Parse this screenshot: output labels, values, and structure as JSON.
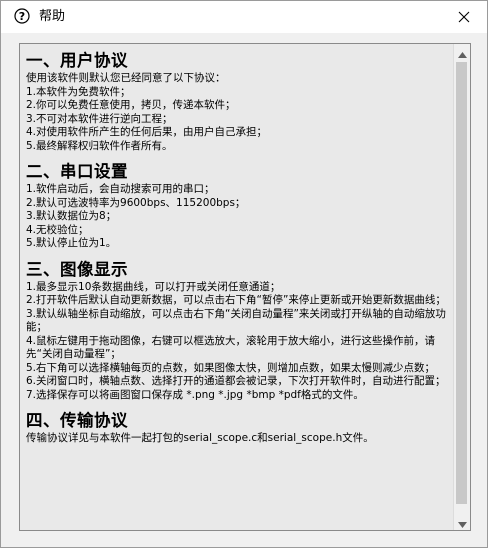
{
  "window": {
    "title": "帮助"
  },
  "sections": [
    {
      "heading": "一、用户协议",
      "lines": [
        "使用该软件则默认您已经同意了以下协议：",
        "1.本软件为免费软件；",
        "2.你可以免费任意使用，拷贝，传递本软件；",
        "3.不可对本软件进行逆向工程；",
        "4.对使用软件所产生的任何后果，由用户自己承担；",
        "5.最终解释权归软件作者所有。"
      ]
    },
    {
      "heading": "二、串口设置",
      "lines": [
        "1.软件启动后，会自动搜索可用的串口；",
        "2.默认可选波特率为9600bps、115200bps；",
        "3.默认数据位为8；",
        "4.无校验位；",
        "5.默认停止位为1。"
      ]
    },
    {
      "heading": "三、图像显示",
      "lines": [
        "1.最多显示10条数据曲线，可以打开或关闭任意通道；",
        "2.打开软件后默认自动更新数据，可以点击右下角“暂停”来停止更新或开始更新数据曲线；",
        "3.默认纵轴坐标自动缩放，可以点击右下角“关闭自动量程”来关闭或打开纵轴的自动缩放功能；",
        "4.鼠标左键用于拖动图像，右键可以框选放大，滚轮用于放大缩小，进行这些操作前，请先“关闭自动量程”；",
        "5.右下角可以选择横轴每页的点数，如果图像太快，则增加点数，如果太慢则减少点数；",
        "6.关闭窗口时，横轴点数、选择打开的通道都会被记录，下次打开软件时，自动进行配置；",
        "7.选择保存可以将画图窗口保存成 *.png *.jpg *bmp *pdf格式的文件。"
      ]
    },
    {
      "heading": "四、传输协议",
      "lines": [
        "传输协议详见与本软件一起打包的serial_scope.c和serial_scope.h文件。"
      ]
    }
  ]
}
